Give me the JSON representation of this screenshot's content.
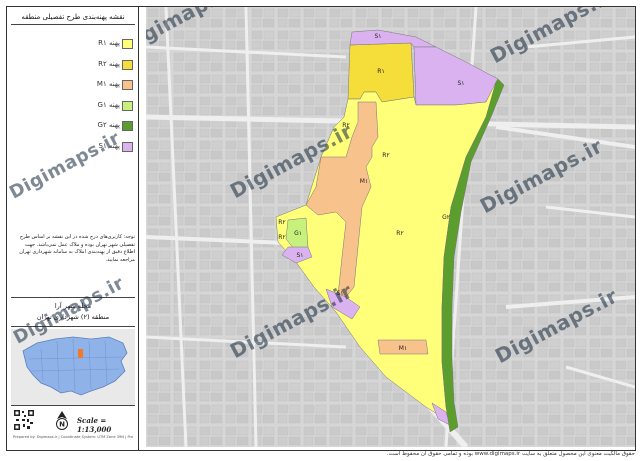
{
  "title": "نقشه پهنه‌بندی طرح تفصیلی منطقه",
  "legend": [
    {
      "code": "R۱",
      "label": "پهنه R۱",
      "color": "#ffff7a"
    },
    {
      "code": "R۲",
      "label": "پهنه R۲",
      "color": "#f5dd3a"
    },
    {
      "code": "M۱",
      "label": "پهنه M۱",
      "color": "#f7c28b"
    },
    {
      "code": "G۱",
      "label": "پهنه G۱",
      "color": "#c8f07d"
    },
    {
      "code": "G۲",
      "label": "پهنه G۲",
      "color": "#5c9e2e"
    },
    {
      "code": "S۱",
      "label": "پهنه S۱",
      "color": "#d9b2ef"
    }
  ],
  "note": "توجه: کاربری‌های درج شده در این نقشه بر اساس طرح تفصیلی شهر تهران بوده و ملاک عمل نمی‌باشد. جهت اطلاع دقیق از پهنه‌بندی املاک به سامانه شهرداری تهران مراجعه نمایید.",
  "area": {
    "neighborhood": "محله شهر آرا",
    "district": "منطقه (۲) شهرداری تهران"
  },
  "scale": "Scale = 1:13,000",
  "footer": "Prepared by: Digimaps.ir | Coordinate System: UTM Zone 39N | Projection: Transverse Mercator",
  "copyright": "حقوق مالکیت معنوی این محصول متعلق به سایت www.digimaps.ir بوده و تمامی حقوق آن محفوظ است.",
  "watermark": "Digimaps.ir",
  "zone_labels": [
    "R۱",
    "R۲",
    "R۲",
    "M۱",
    "R۲",
    "G۱",
    "R۲",
    "S۱",
    "S۱",
    "S۱",
    "M۱",
    "G۲",
    "S۱",
    "R۲"
  ],
  "colors": {
    "r1": "#ffff7a",
    "r2": "#f5dd3a",
    "m1": "#f7c28b",
    "g1": "#c8f07d",
    "g2": "#5c9e2e",
    "s1": "#d9b2ef",
    "base": "#d4d4d4",
    "road": "#f2f2f2"
  }
}
